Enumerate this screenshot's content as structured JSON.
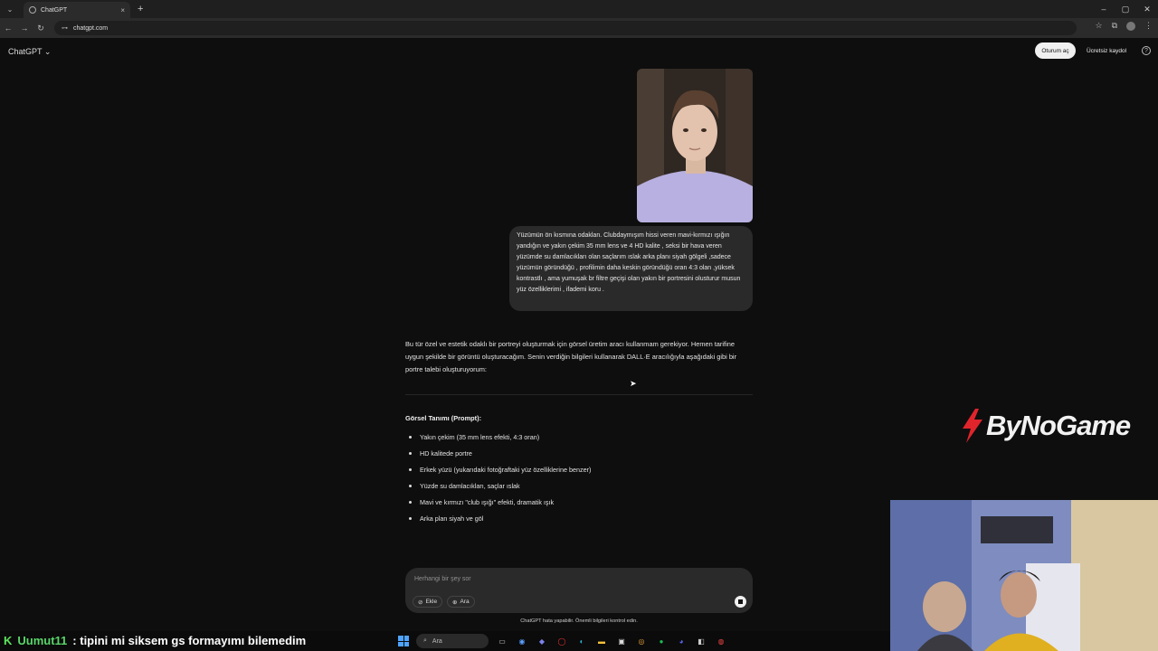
{
  "browser": {
    "tab_title": "ChatGPT",
    "url": "chatgpt.com",
    "new_tab_symbol": "+",
    "close_symbol": "×"
  },
  "header": {
    "app_title": "ChatGPT",
    "login_label": "Oturum aç",
    "signup_label": "Ücretsiz kaydol",
    "help_symbol": "?"
  },
  "chat": {
    "user_message": "Yüzümün ön kısmına odaklan. Clubdaymışım hissi veren mavi-kırmızı ışığın yandığın ve yakın çekim 35 mm lens ve 4 HD kalite , seksi bir hava veren yüzümde su damlacıkları olan saçlarım ıslak arka planı siyah gölgeli ,sadece yüzümün göründüğü , profilimin daha keskin göründüğü oran 4:3 olan ,yüksek kontrastlı , ama yumuşak br filtre geçişi olan yakın bir portresini olusturur musun yüz özelliklerimi , ifademi koru .",
    "assistant_intro": "Bu tür özel ve estetik odaklı bir portreyi oluşturmak için görsel üretim aracı kullanmam gerekiyor. Hemen tarifine uygun şekilde bir görüntü oluşturacağım. Senin verdiğin bilgileri kullanarak DALL·E aracılığıyla aşağıdaki gibi bir portre talebi oluşturuyorum:",
    "prompt_heading": "Görsel Tanımı (Prompt):",
    "prompt_items": [
      "Yakın çekim (35 mm lens efekti, 4:3 oran)",
      "HD kalitede portre",
      "Erkek yüzü (yukarıdaki fotoğraftaki yüz özelliklerine benzer)",
      "Yüzde su damlacıkları, saçlar ıslak",
      "Mavi ve kırmızı \"club ışığı\" efekti, dramatik ışık",
      "Arka plan siyah ve göl"
    ]
  },
  "composer": {
    "placeholder": "Herhangi bir şey sor",
    "add_label": "Ekle",
    "search_label": "Ara",
    "disclaimer": "ChatGPT hata yapabilir. Önemli bilgileri kontrol edin."
  },
  "overlay": {
    "logo_text": "ByNoGame",
    "chat_badge": "K",
    "chat_user": "Uumut11",
    "chat_message": ": tipini mi siksem gs formayımı bilemedim"
  },
  "taskbar": {
    "search_placeholder": "Ara"
  }
}
